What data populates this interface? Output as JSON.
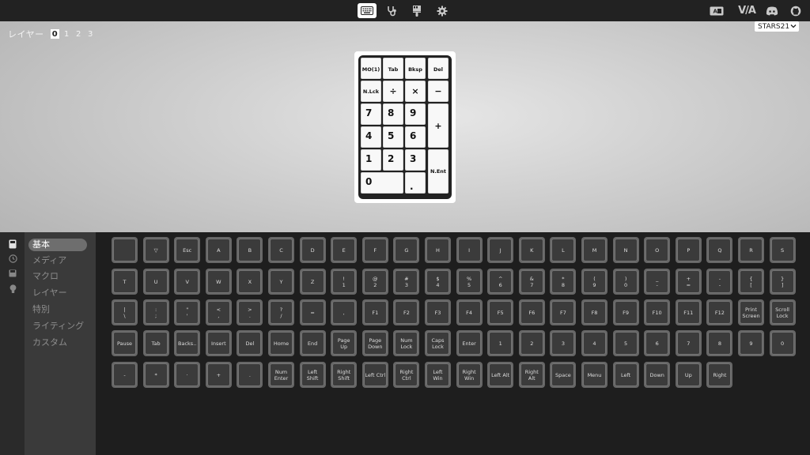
{
  "topbar": {
    "tabs": [
      {
        "name": "keymap",
        "icon": "keyboard-icon",
        "active": true
      },
      {
        "name": "test",
        "icon": "stethoscope-icon"
      },
      {
        "name": "design",
        "icon": "brush-icon"
      },
      {
        "name": "settings",
        "icon": "gear-icon"
      }
    ],
    "via_label": "V/A",
    "right_icons": [
      "keyboard-language-icon",
      "via-logo-icon",
      "discord-icon",
      "github-icon"
    ]
  },
  "canvas": {
    "layer_label": "レイヤー",
    "layers": [
      "0",
      "1",
      "2",
      "3"
    ],
    "active_layer": "0",
    "keyboard_name": "STARS21",
    "board_keys": [
      {
        "label": "MO(1)"
      },
      {
        "label": "Tab"
      },
      {
        "label": "Bksp"
      },
      {
        "label": "Del"
      },
      {
        "label": "N.Lck"
      },
      {
        "label": "÷"
      },
      {
        "label": "×"
      },
      {
        "label": "−"
      },
      {
        "label": "7"
      },
      {
        "label": "8"
      },
      {
        "label": "9"
      },
      {
        "label": "+"
      },
      {
        "label": "4"
      },
      {
        "label": "5"
      },
      {
        "label": "6"
      },
      {
        "label": "1"
      },
      {
        "label": "2"
      },
      {
        "label": "3"
      },
      {
        "label": "N.Ent"
      },
      {
        "label": "0"
      },
      {
        "label": "."
      }
    ]
  },
  "sidebar": {
    "icons": [
      "keyboard-icon",
      "clock-icon",
      "save-icon",
      "lightbulb-icon"
    ],
    "categories": [
      "基本",
      "メディア",
      "マクロ",
      "レイヤー",
      "特別",
      "ライティング",
      "カスタム"
    ],
    "active_category": "基本"
  },
  "palette": {
    "rows": [
      [
        "",
        "▽",
        "Esc",
        "A",
        "B",
        "C",
        "D",
        "E",
        "F",
        "G",
        "H",
        "I",
        "J",
        "K",
        "L",
        "M",
        "N",
        "O",
        "P",
        "Q",
        "R",
        "S"
      ],
      [
        "T",
        "U",
        "V",
        "W",
        "X",
        "Y",
        "Z",
        "!\n1",
        "@\n2",
        "#\n3",
        "$\n4",
        "%\n5",
        "^\n6",
        "&\n7",
        "*\n8",
        "(\n9",
        ")\n0",
        "_\n-",
        "+\n=",
        "-\n-",
        "{\n[",
        "}\n]"
      ],
      [
        "|\n\\",
        ":\n;",
        "\"\n'",
        "<\n,",
        ">\n.",
        "?\n/",
        "=",
        ",",
        "F1",
        "F2",
        "F3",
        "F4",
        "F5",
        "F6",
        "F7",
        "F8",
        "F9",
        "F10",
        "F11",
        "F12",
        "Print\nScreen",
        "Scroll\nLock"
      ],
      [
        "Pause",
        "Tab",
        "Backs..",
        "Insert",
        "Del",
        "Home",
        "End",
        "Page\nUp",
        "Page\nDown",
        "Num\nLock",
        "Caps\nLock",
        "Enter",
        "1",
        "2",
        "3",
        "4",
        "5",
        "6",
        "7",
        "8",
        "9",
        "0"
      ],
      [
        "-",
        "*",
        "·",
        "+",
        ".",
        "Num\nEnter",
        "Left\nShift",
        "Right\nShift",
        "Left Ctrl",
        "Right\nCtrl",
        "Left\nWin",
        "Right\nWin",
        "Left Alt",
        "Right\nAlt",
        "Space",
        "Menu",
        "Left",
        "Down",
        "Up",
        "Right"
      ]
    ]
  }
}
